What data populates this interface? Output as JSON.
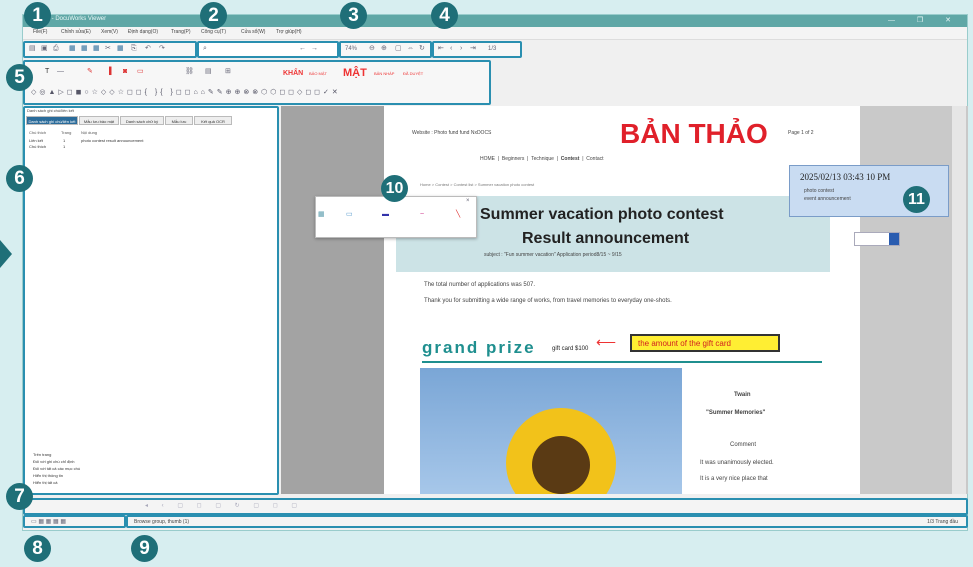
{
  "window": {
    "title": "... - DocuWorks Viewer",
    "controls": "—  ❐  ✕"
  },
  "menubar": {
    "items": [
      "File(F)",
      "Chỉnh sửa(E)",
      "Xem(V)",
      "Định dạng(O)",
      "Trang(P)",
      "Công cụ(T)",
      "Cửa sổ(W)",
      "Trợ giúp(H)"
    ]
  },
  "toolbar": {
    "zoom_value": "74%",
    "page_value": "1/3"
  },
  "annotation_toolbar": {
    "stamp_khan": "KHẨN",
    "stamp_mat": "MẬT",
    "stamp_small1": "BẢO MẬT",
    "stamp_small2": "BẢN NHÁP",
    "stamp_small3": "ĐÃ DUYỆT"
  },
  "left_panel": {
    "header": "Danh sách ghi chú/liên kết",
    "tabs": [
      "Danh sách ghi chú/liên kết",
      "Mẫu lưu bảo mật",
      "Danh sách chữ ký",
      "Mẫu lưu",
      "Kết quả OCR"
    ],
    "columns": [
      "Chú thích",
      "Trang",
      "Nội dung"
    ],
    "rows": [
      {
        "type": "Liên kết",
        "page": "1",
        "content": "photo contest result announcement"
      },
      {
        "type": "Chú thích",
        "page": "1",
        "content": ""
      }
    ],
    "options": [
      "Trên trang",
      "Đối với ghi chú chỉ định",
      "Đối với tất cả các mục chú",
      "Hiển thị thông tin",
      "Hiển thị tất cả"
    ]
  },
  "document": {
    "site": "Website : Photo fund fund NxDOCS",
    "watermark": "BẢN THẢO",
    "page_label": "Page 1 of 2",
    "nav": [
      "HOME",
      "Beginners",
      "Technique",
      "Contest",
      "Contact"
    ],
    "breadcrumb": "Home  >  Contest  >  Contest list  >  Summer vacation photo contest",
    "title_line1": "Summer vacation photo contest",
    "title_line2": "Result announcement",
    "subject": "subject : \"Fun summer vacation\" Application period8/15 ~ 9/15",
    "para1": "The total number of applications was 507.",
    "para2": "Thank you for submitting a wide range of works, from travel memories to everyday one-shots.",
    "prize_heading": "grand prize",
    "gift_card": "gift card $100",
    "gift_callout": "the amount of the gift card",
    "winner_name": "Twain",
    "winner_title": "\"Summer Memories\"",
    "comment_label": "Comment",
    "comment_line1": "It was unanimously elected.",
    "comment_line2": "It is a very nice place that"
  },
  "sticky_note": {
    "timestamp": "2025/02/13 03:43 10 PM",
    "line1": "photo contest",
    "line2": "event announcement"
  },
  "statusbar": {
    "message": "Browse group, thumb (1)",
    "right": "1/3  Trang đầu"
  },
  "badges": [
    "1",
    "2",
    "3",
    "4",
    "5",
    "6",
    "7",
    "8",
    "9",
    "10",
    "11"
  ],
  "colors": {
    "accent": "#2a8fb0",
    "badge": "#1f6f78",
    "title_bar": "#5fa7a6",
    "watermark_red": "#e0202a",
    "prize_teal": "#1f8f8f",
    "callout_yellow": "#ffee33",
    "note_blue": "#c9dcf2"
  },
  "icons": [
    "folder-icon",
    "save-icon",
    "print-icon",
    "search-icon",
    "zoom-in-icon",
    "zoom-out-icon",
    "first-page-icon",
    "prev-page-icon",
    "next-page-icon",
    "last-page-icon",
    "pen-icon",
    "highlighter-icon",
    "stamp-icon",
    "shape-icon",
    "close-icon",
    "arrow-icon"
  ]
}
